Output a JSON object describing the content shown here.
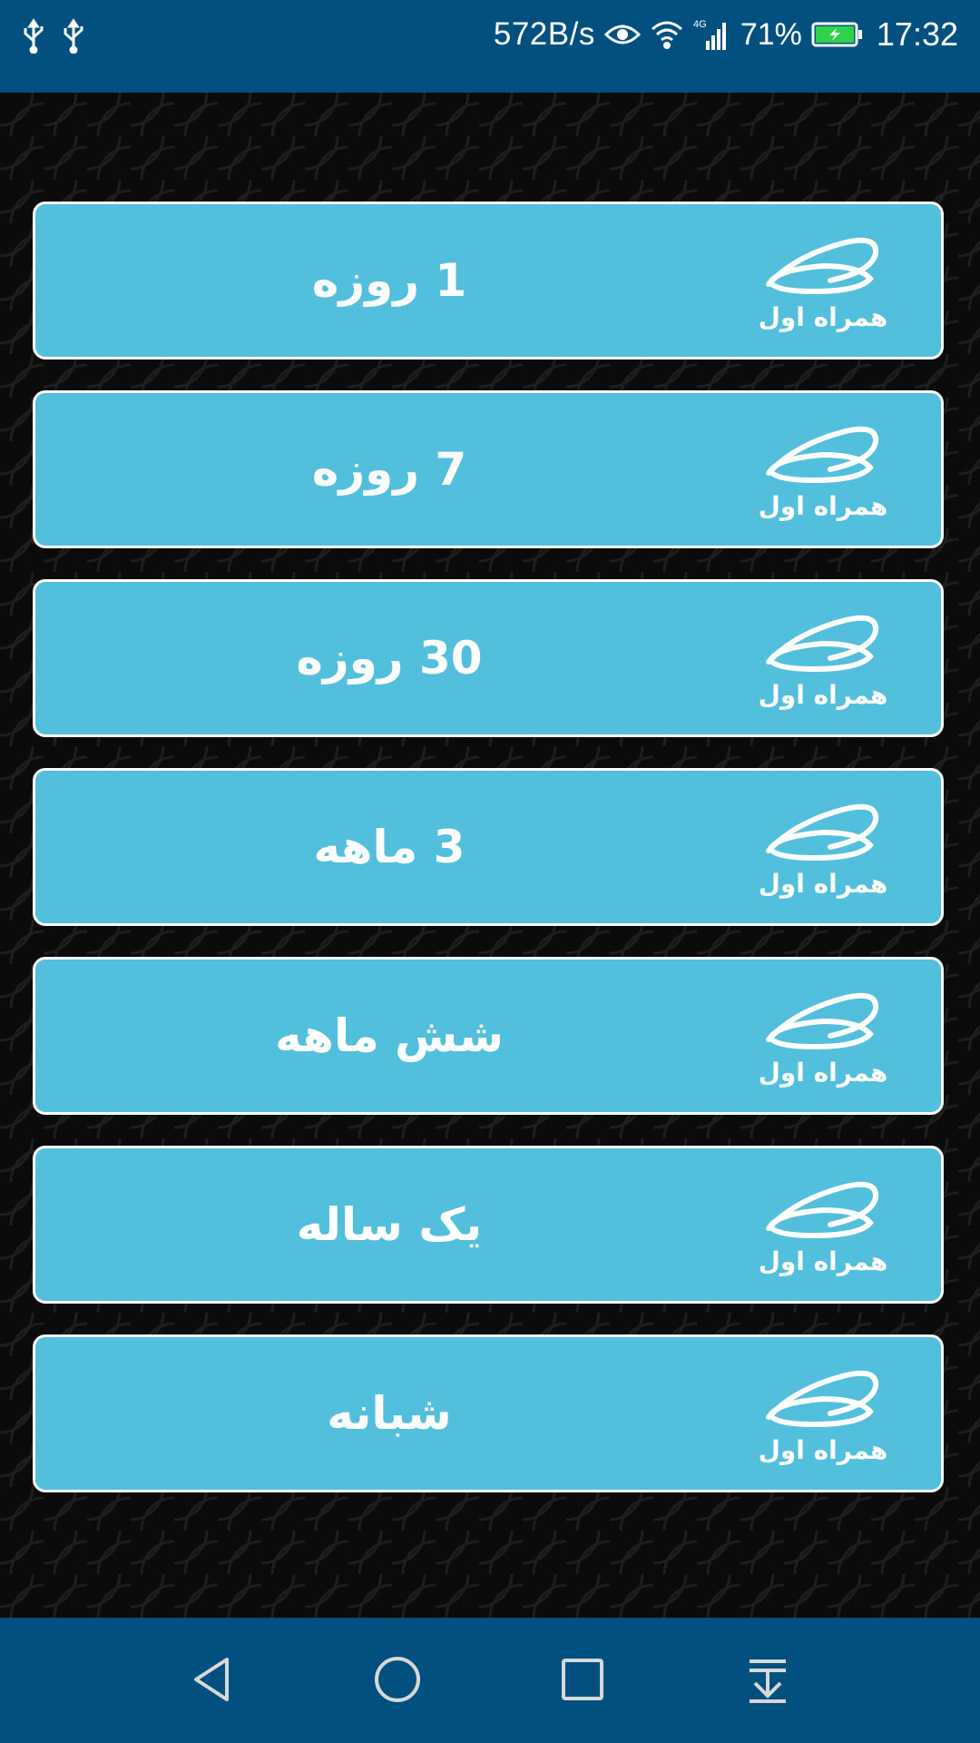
{
  "status_bar": {
    "net_speed": "572B/s",
    "battery_percent": "71%",
    "time": "17:32",
    "network_type": "4G",
    "left_icons": [
      "usb-icon",
      "usb-icon"
    ],
    "right_icons": [
      "eye-icon",
      "wifi-icon",
      "signal-icon",
      "battery-charging-icon"
    ]
  },
  "packages": [
    {
      "label": "1 روزه"
    },
    {
      "label": "7 روزه"
    },
    {
      "label": "30 روزه"
    },
    {
      "label": "3 ماهه"
    },
    {
      "label": "شش ماهه"
    },
    {
      "label": "یک ساله"
    },
    {
      "label": "شبانه"
    }
  ],
  "logo": {
    "text": "همراه اول",
    "icon": "hamrahe-aval-logo"
  },
  "nav_bar": {
    "buttons": [
      "back-icon",
      "home-icon",
      "recents-icon",
      "notification-pulldown-icon"
    ]
  },
  "colors": {
    "status_bar": "#02507f",
    "nav_bar": "#02507f",
    "button": "#52bfdc",
    "button_border": "#ffffff",
    "background": "#0b0b0b"
  }
}
